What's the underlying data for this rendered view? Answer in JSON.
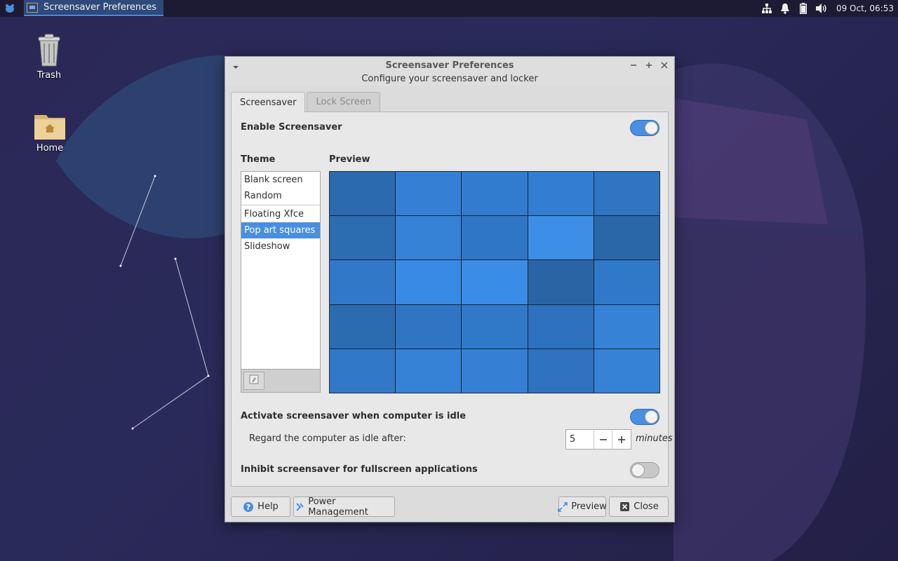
{
  "panel": {
    "task_title": "Screensaver Preferences",
    "clock": "09 Oct, 06:53",
    "tray_icons": [
      "network-icon",
      "notifications-icon",
      "battery-icon",
      "volume-icon"
    ]
  },
  "desktop": {
    "icons": [
      {
        "label": "Trash",
        "icon": "trash-icon"
      },
      {
        "label": "Home",
        "icon": "home-folder-icon"
      }
    ]
  },
  "window": {
    "title": "Screensaver Preferences",
    "subtitle": "Configure your screensaver and locker",
    "tabs": [
      {
        "label": "Screensaver",
        "active": true
      },
      {
        "label": "Lock Screen",
        "active": false
      }
    ],
    "enable_screensaver": {
      "label": "Enable Screensaver",
      "on": true
    },
    "theme": {
      "heading": "Theme",
      "items": [
        "Blank screen",
        "Random",
        "Floating Xfce",
        "Pop art squares",
        "Slideshow"
      ],
      "selected": "Pop art squares"
    },
    "preview": {
      "heading": "Preview",
      "colors": [
        [
          "#2b6aae",
          "#3580d4",
          "#327ccf",
          "#337ed2",
          "#2f75c2"
        ],
        [
          "#2c6cb0",
          "#3582d6",
          "#2f76c6",
          "#3d8ee6",
          "#2a67a9"
        ],
        [
          "#3179c8",
          "#398ae2",
          "#3a8de6",
          "#2a64a4",
          "#3079c8"
        ],
        [
          "#2b6bb0",
          "#2f75c4",
          "#3079c8",
          "#2e71be",
          "#3582d6"
        ],
        [
          "#3179c8",
          "#3582d6",
          "#3580d4",
          "#2f73c0",
          "#3582d6"
        ]
      ]
    },
    "activate_idle": {
      "label": "Activate screensaver when computer is idle",
      "on": true
    },
    "idle_after": {
      "label": "Regard the computer as idle after:",
      "value": "5",
      "unit": "minutes"
    },
    "inhibit_fullscreen": {
      "label": "Inhibit screensaver for fullscreen applications",
      "on": false
    },
    "buttons": {
      "help": "Help",
      "power_management": "Power Management",
      "preview": "Preview",
      "close": "Close"
    },
    "accent_color": "#4a8ee0"
  }
}
